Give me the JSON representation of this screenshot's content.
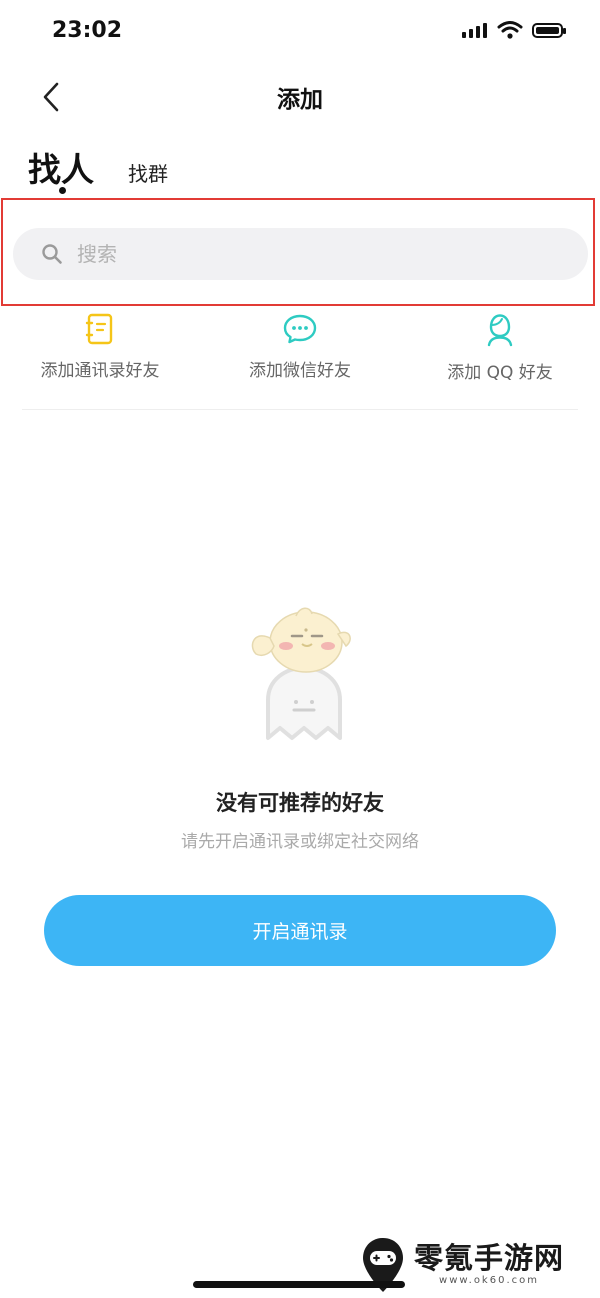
{
  "status_bar": {
    "time": "23:02"
  },
  "header": {
    "title": "添加",
    "back_icon": "chevron-left-icon"
  },
  "tabs": [
    {
      "label": "找人",
      "active": true
    },
    {
      "label": "找群",
      "active": false
    }
  ],
  "search": {
    "placeholder": "搜索",
    "value": ""
  },
  "quick_add": [
    {
      "label": "添加通讯录好友",
      "icon": "contacts-book-icon",
      "color": "#f5c518"
    },
    {
      "label": "添加微信好友",
      "icon": "wechat-icon",
      "color": "#2ecbc2"
    },
    {
      "label": "添加 QQ 好友",
      "icon": "qq-user-icon",
      "color": "#2ecbc2"
    }
  ],
  "empty_state": {
    "title": "没有可推荐的好友",
    "subtitle": "请先开启通讯录或绑定社交网络"
  },
  "primary_button": {
    "label": "开启通讯录",
    "color": "#3db5f5"
  },
  "watermark": {
    "name": "零氪手游网",
    "url": "www.ok60.com"
  },
  "colors": {
    "highlight_border": "#e23b35",
    "search_bg": "#f1f1f3"
  }
}
